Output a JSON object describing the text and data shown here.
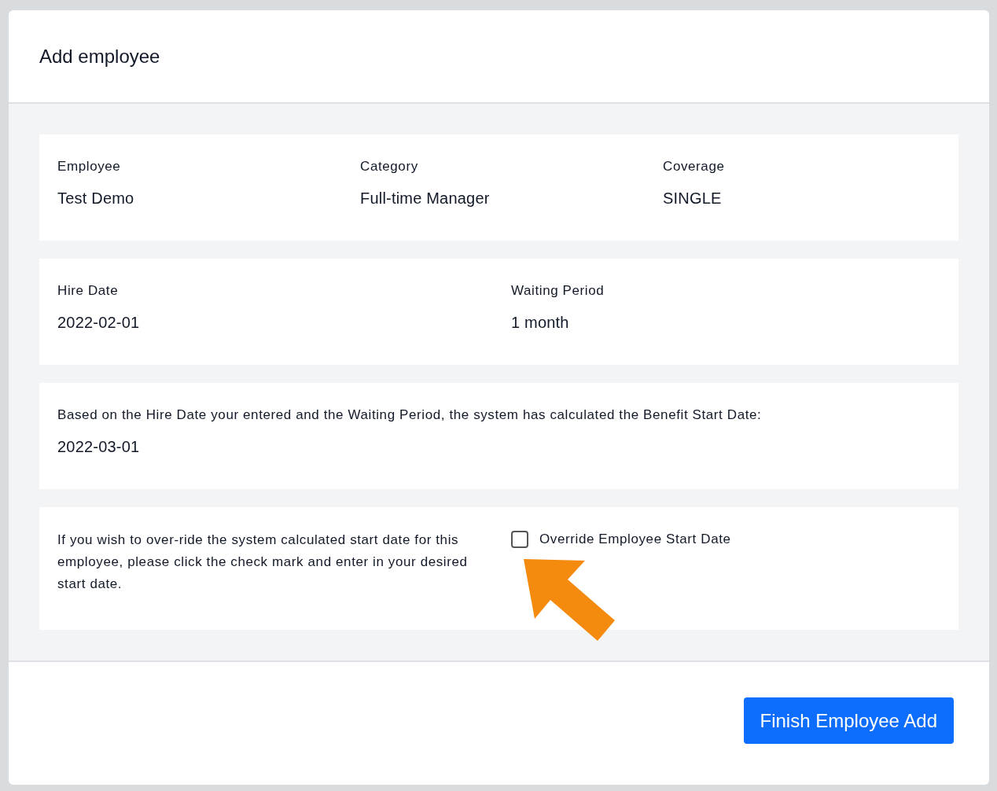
{
  "dialog": {
    "title": "Add employee"
  },
  "summary": [
    {
      "label": "Employee",
      "value": "Test Demo"
    },
    {
      "label": "Category",
      "value": "Full-time Manager"
    },
    {
      "label": "Coverage",
      "value": "SINGLE"
    }
  ],
  "dates": [
    {
      "label": "Hire Date",
      "value": "2022-02-01"
    },
    {
      "label": "Waiting Period",
      "value": "1 month"
    }
  ],
  "benefit": {
    "text": "Based on the Hire Date your entered and the Waiting Period, the system has calculated the Benefit Start Date:",
    "date": "2022-03-01"
  },
  "override": {
    "text": "If you wish to over-ride the system calculated start date for this employee, please click the check mark and enter in your desired start date.",
    "checkbox": {
      "label": "Override Employee Start Date",
      "checked": false
    }
  },
  "finish_button": "Finish Employee Add"
}
